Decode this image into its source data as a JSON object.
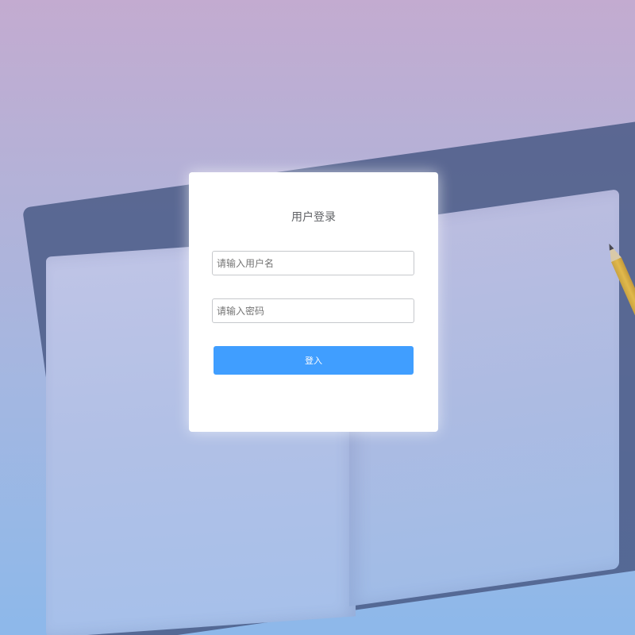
{
  "login": {
    "title": "用户登录",
    "username_placeholder": "请输入用户名",
    "password_placeholder": "请输入密码",
    "submit_label": "登入"
  },
  "colors": {
    "accent": "#409eff",
    "card_background": "#ffffff",
    "background_top": "#c3abd0",
    "background_bottom": "#8db8ea"
  }
}
